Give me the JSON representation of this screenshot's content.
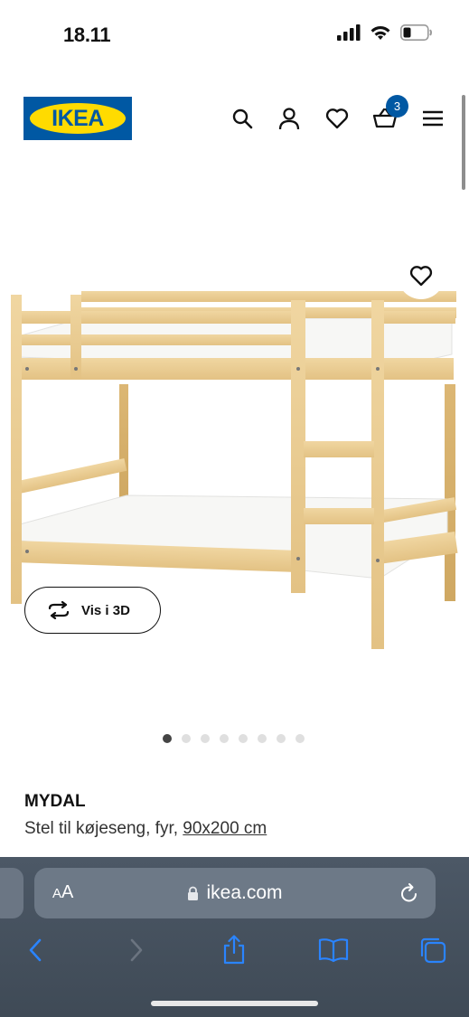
{
  "status_bar": {
    "time": "18.11",
    "icons": [
      "cellular-signal-icon",
      "wifi-icon",
      "battery-icon"
    ]
  },
  "header": {
    "logo_text": "IKEA",
    "icons": [
      "search-icon",
      "account-icon",
      "favorites-icon",
      "cart-icon",
      "menu-icon"
    ],
    "cart_count": "3",
    "brand_blue": "#0058A3",
    "brand_yellow": "#FFDB00"
  },
  "product_image": {
    "view_3d_label": "Vis i 3D",
    "image_count": 8,
    "active_image": 1
  },
  "product": {
    "name": "MYDAL",
    "description": "Stel til køjeseng, fyr, ",
    "size": "90x200 cm"
  },
  "browser": {
    "text_size_small": "A",
    "text_size_large": "A",
    "url": "ikea.com",
    "toolbar_icons": [
      "back-icon",
      "forward-icon",
      "share-icon",
      "bookmarks-icon",
      "tabs-icon"
    ]
  }
}
